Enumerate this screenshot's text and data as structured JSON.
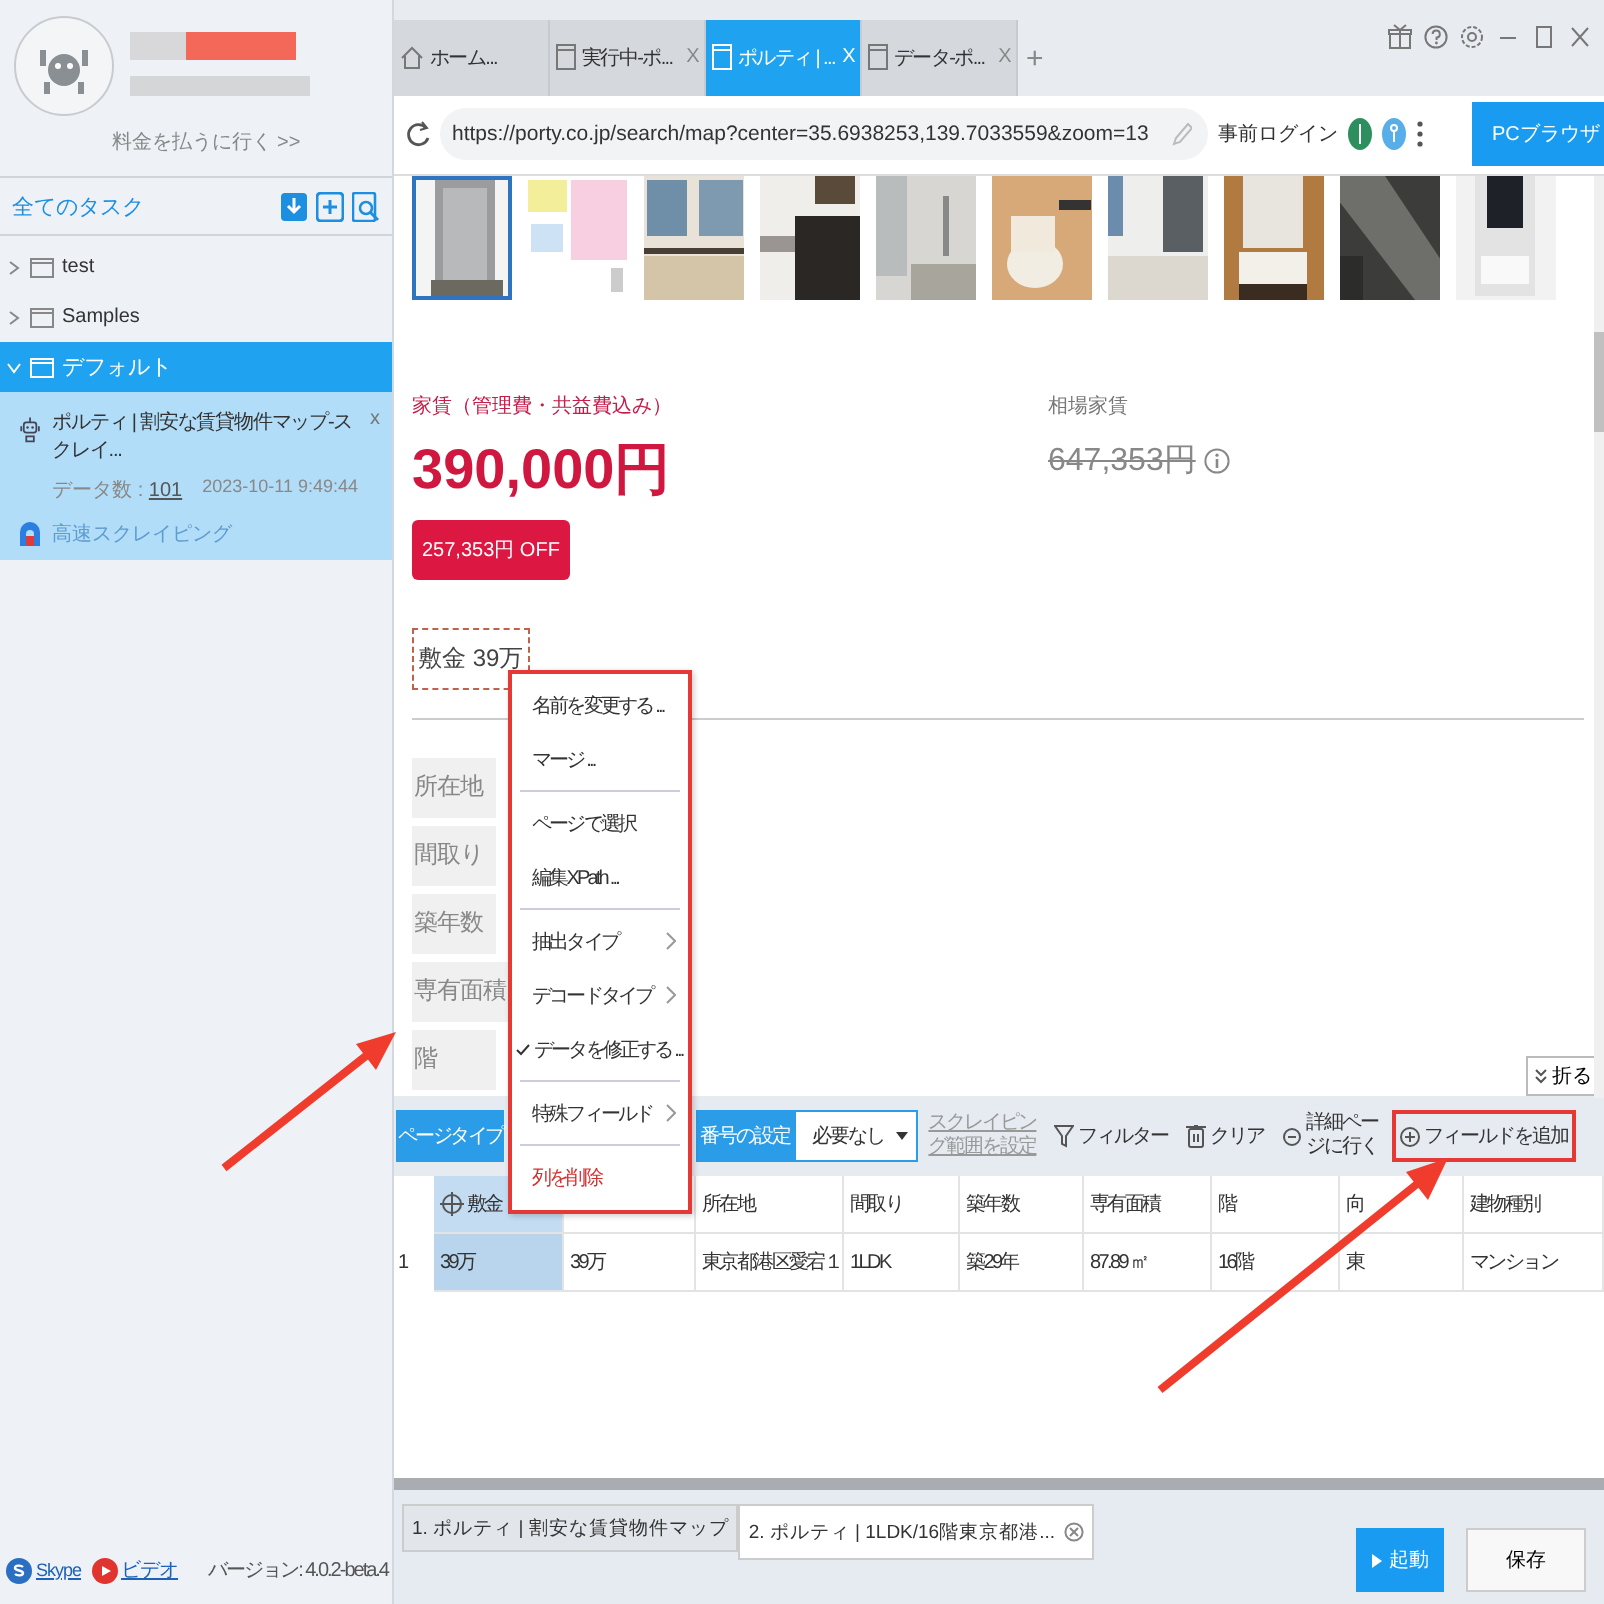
{
  "sidebar": {
    "pay_link": "料金を払うに行く >>",
    "tasks_title": "全てのタスク",
    "folders": [
      {
        "name": "test",
        "expanded": false,
        "selected": false
      },
      {
        "name": "Samples",
        "expanded": false,
        "selected": false
      },
      {
        "name": "デフォルト",
        "expanded": true,
        "selected": true,
        "tasks": [
          {
            "title": "ポルティ | 割安な賃貸物件マップ-スクレイ...",
            "close": "x",
            "count_label": "データ数 :",
            "count": "101",
            "date": "2023-10-11 9:49:44",
            "mode": "高速スクレイピング"
          }
        ]
      }
    ],
    "links": [
      {
        "kind": "skype",
        "label": "Skype"
      },
      {
        "kind": "video",
        "label": "ビデオ"
      }
    ],
    "version": "バージョン: 4.0.2-beta.4"
  },
  "browser_tabs": [
    {
      "kind": "home",
      "label": "ホーム...",
      "selected": false
    },
    {
      "kind": "page",
      "label": "実行中-ポ...",
      "close": "X",
      "selected": false
    },
    {
      "kind": "page",
      "label": "ポルティ | ...",
      "close": "X",
      "selected": true
    },
    {
      "kind": "page",
      "label": "データ-ポ...",
      "close": "X",
      "selected": false
    }
  ],
  "new_tab": "+",
  "window_controls": [
    {
      "kind": "gift"
    },
    {
      "kind": "help"
    },
    {
      "kind": "settings"
    },
    {
      "kind": "minimize"
    },
    {
      "kind": "maximize"
    },
    {
      "kind": "close"
    }
  ],
  "address_bar": {
    "url": "https://porty.co.jp/search/map?center=35.6938253,139.7033559&zoom=13",
    "prelogin": "事前ログイン",
    "browser_mode": "PCブラウザ"
  },
  "page": {
    "thumbnails": [
      {
        "kind": "picture",
        "selected": true
      },
      {
        "kind": "picture",
        "selected": false
      },
      {
        "kind": "picture",
        "selected": false
      },
      {
        "kind": "picture",
        "selected": false
      },
      {
        "kind": "picture",
        "selected": false
      },
      {
        "kind": "picture",
        "selected": false
      },
      {
        "kind": "picture",
        "selected": false
      },
      {
        "kind": "picture",
        "selected": false
      },
      {
        "kind": "picture",
        "selected": false
      },
      {
        "kind": "picture",
        "selected": false
      }
    ],
    "rent_label": "家賃（管理費・共益費込み）",
    "rent": "390,000円",
    "discount": "257,353円 OFF",
    "market_label": "相場家賃",
    "market_price": "647,353円",
    "deposit": {
      "label": "敷金",
      "value": "39万"
    },
    "fields": [
      "所在地",
      "間取り",
      "築年数",
      "専有面積",
      "階"
    ],
    "collapse": "折る"
  },
  "menu": {
    "items": [
      {
        "kind": "item",
        "label": "名前を変更する ...",
        "checked": false,
        "separator_before": false
      },
      {
        "kind": "item",
        "label": "マージ ...",
        "checked": false,
        "separator_before": false
      },
      {
        "kind": "item",
        "label": "ページで選択",
        "checked": false,
        "separator_before": true
      },
      {
        "kind": "item",
        "label": "編集XPath ...",
        "checked": false,
        "separator_before": false
      },
      {
        "kind": "submenu",
        "label": "抽出タイプ",
        "checked": false,
        "separator_before": true
      },
      {
        "kind": "submenu",
        "label": "デコードタイプ",
        "checked": false,
        "separator_before": false
      },
      {
        "kind": "item",
        "label": "データを修正する ...",
        "checked": true,
        "separator_before": false
      },
      {
        "kind": "submenu",
        "label": "特殊フィールド",
        "checked": false,
        "separator_before": true
      },
      {
        "kind": "danger",
        "label": "列を削除",
        "checked": false,
        "separator_before": true
      }
    ]
  },
  "toolbar": {
    "page_type": "ページタイプ",
    "numbering": "番号の設定",
    "numbering_value": "必要なし",
    "range_link": "スクレイピング範囲を設定",
    "actions": [
      {
        "kind": "filter",
        "label": "フィルター",
        "highlighted": false
      },
      {
        "kind": "clear",
        "label": "クリア",
        "highlighted": false
      },
      {
        "kind": "detail",
        "label": "詳細ページに行く",
        "highlighted": false
      },
      {
        "kind": "add",
        "label": "フィールドを追加",
        "highlighted": true
      }
    ]
  },
  "table": {
    "columns": [
      {
        "label": "敷金",
        "selected": true
      },
      {
        "selected": false
      },
      {
        "label": "所在地",
        "selected": false
      },
      {
        "label": "間取り",
        "selected": false
      },
      {
        "label": "築年数",
        "selected": false
      },
      {
        "label": "専有面積",
        "selected": false
      },
      {
        "label": "階",
        "selected": false
      },
      {
        "label": "向",
        "selected": false
      },
      {
        "label": "建物種別",
        "selected": false
      }
    ],
    "rows": [
      {
        "index": "1",
        "cells": [
          "39万",
          "39万",
          "東京都港区愛宕１",
          "1LDK",
          "築29年",
          "87.89 ㎡",
          "16階",
          "東",
          "マンション"
        ]
      }
    ]
  },
  "page_tabs": [
    {
      "label": "1. ポルティ | 割安な賃貸物件マップ",
      "selected": false,
      "closable": false
    },
    {
      "label": "2. ポルティ | 1LDK/16階東京都港...",
      "selected": true,
      "closable": true
    }
  ],
  "buttons": [
    {
      "kind": "primary",
      "label": "起動"
    },
    {
      "kind": "secondary",
      "label": "保存"
    }
  ]
}
